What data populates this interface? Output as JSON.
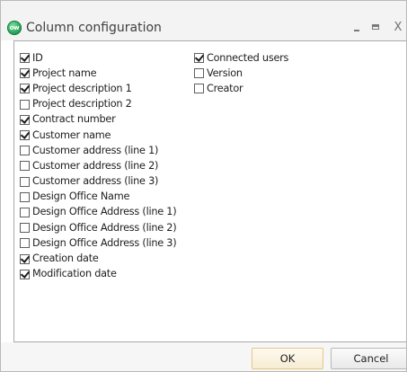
{
  "window": {
    "title": "Column configuration",
    "icon_text": "ow",
    "icon": "app-logo-icon",
    "controls": {
      "minimize_icon": "minimize-icon",
      "maximize_icon": "maximize-icon",
      "close_label": "X"
    }
  },
  "columns": {
    "left": [
      {
        "label": "ID",
        "checked": true
      },
      {
        "label": "Project name",
        "checked": true
      },
      {
        "label": "Project description 1",
        "checked": true
      },
      {
        "label": "Project description 2",
        "checked": false
      },
      {
        "label": "Contract number",
        "checked": true
      },
      {
        "label": "Customer name",
        "checked": true
      },
      {
        "label": "Customer address (line 1)",
        "checked": false
      },
      {
        "label": "Customer address (line 2)",
        "checked": false
      },
      {
        "label": "Customer address (line 3)",
        "checked": false
      },
      {
        "label": "Design Office Name",
        "checked": false
      },
      {
        "label": "Design Office Address (line 1)",
        "checked": false
      },
      {
        "label": "Design Office Address (line 2)",
        "checked": false
      },
      {
        "label": "Design Office Address (line 3)",
        "checked": false
      },
      {
        "label": "Creation date",
        "checked": true
      },
      {
        "label": "Modification date",
        "checked": true
      }
    ],
    "right": [
      {
        "label": "Connected users",
        "checked": true
      },
      {
        "label": "Version",
        "checked": false
      },
      {
        "label": "Creator",
        "checked": false
      }
    ]
  },
  "footer": {
    "ok_label": "OK",
    "cancel_label": "Cancel"
  },
  "colors": {
    "ok_button_border": "#e2c98a",
    "app_icon": "#2aa860"
  }
}
